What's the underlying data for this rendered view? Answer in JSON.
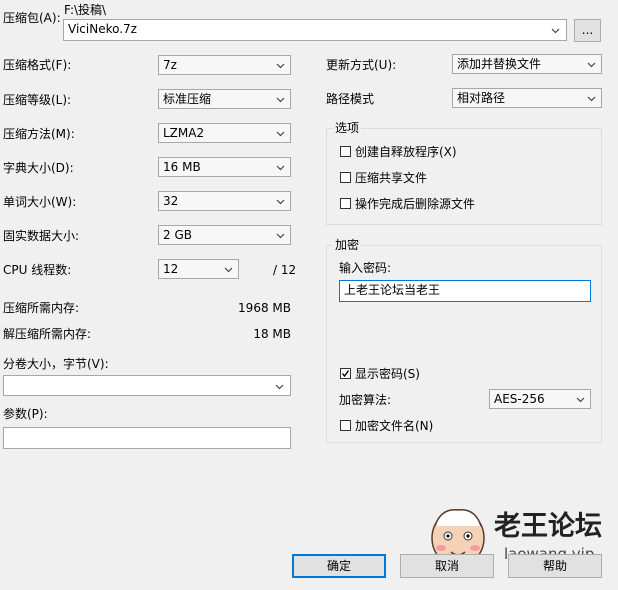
{
  "archive": {
    "label": "压缩包(A):",
    "path": "F:\\投稿\\",
    "name": "ViciNeko.7z",
    "browse_label": "..."
  },
  "left": {
    "format": {
      "label": "压缩格式(F):",
      "value": "7z"
    },
    "level": {
      "label": "压缩等级(L):",
      "value": "标准压缩"
    },
    "method": {
      "label": "压缩方法(M):",
      "value": "LZMA2"
    },
    "dict": {
      "label": "字典大小(D):",
      "value": "16 MB"
    },
    "word": {
      "label": "单词大小(W):",
      "value": "32"
    },
    "solid": {
      "label": "固实数据大小:",
      "value": "2 GB"
    },
    "threads": {
      "label": "CPU 线程数:",
      "value": "12",
      "total": "/ 12"
    },
    "mem_comp": {
      "label": "压缩所需内存:",
      "value": "1968 MB"
    },
    "mem_decomp": {
      "label": "解压缩所需内存:",
      "value": "18 MB"
    },
    "volume": {
      "label": "分卷大小，字节(V):",
      "value": ""
    },
    "params": {
      "label": "参数(P):",
      "value": ""
    }
  },
  "right": {
    "update": {
      "label": "更新方式(U):",
      "value": "添加并替换文件"
    },
    "pathmode": {
      "label": "路径模式",
      "value": "相对路径"
    },
    "options": {
      "title": "选项",
      "items": [
        {
          "label": "创建自释放程序(X)",
          "checked": false
        },
        {
          "label": "压缩共享文件",
          "checked": false
        },
        {
          "label": "操作完成后删除源文件",
          "checked": false
        }
      ]
    },
    "encryption": {
      "title": "加密",
      "password_label": "输入密码:",
      "password_value": "上老王论坛当老王",
      "show_password": {
        "label": "显示密码(S)",
        "checked": true
      },
      "method_label": "加密算法:",
      "method_value": "AES-256",
      "encrypt_names": {
        "label": "加密文件名(N)",
        "checked": false
      }
    }
  },
  "buttons": {
    "ok": "确定",
    "cancel": "取消",
    "help": "帮助"
  },
  "watermark": {
    "title": "老王论坛",
    "url": "laowang.vip"
  }
}
